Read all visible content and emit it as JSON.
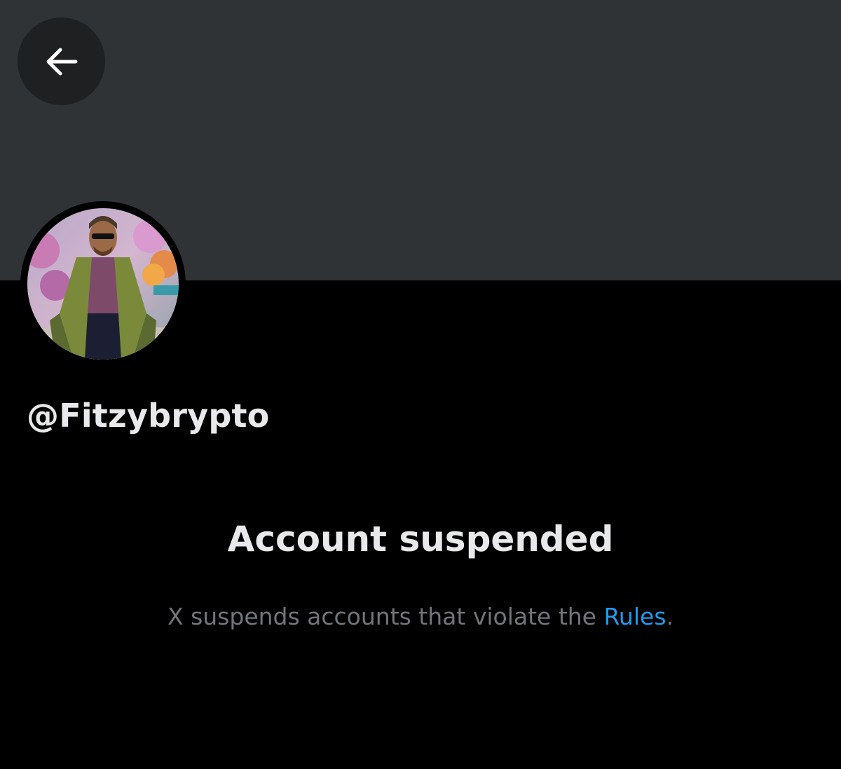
{
  "profile": {
    "handle": "@Fitzybrypto",
    "back_icon": "arrow-left-icon",
    "avatar_description_icon": "avatar-illustration"
  },
  "suspension": {
    "title": "Account suspended",
    "description_prefix": "X suspends accounts that violate the ",
    "rules_link": "Rules",
    "description_suffix": "."
  },
  "colors": {
    "banner": "#2f3336",
    "background": "#000000",
    "text_primary": "#e7e9ea",
    "text_secondary": "#71767b",
    "link": "#1d9bf0"
  }
}
